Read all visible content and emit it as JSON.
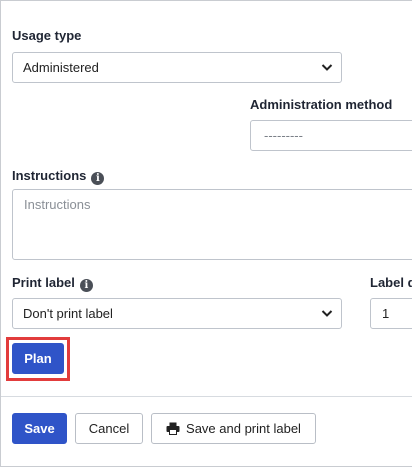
{
  "usage_type": {
    "label": "Usage type",
    "value": "Administered"
  },
  "administration_method": {
    "label": "Administration method",
    "value": "---------"
  },
  "instructions": {
    "label": "Instructions",
    "placeholder": "Instructions"
  },
  "print_label": {
    "label": "Print label",
    "value": "Don't print label"
  },
  "label_quantity": {
    "label": "Label q",
    "value": "1"
  },
  "buttons": {
    "plan": "Plan",
    "save": "Save",
    "cancel": "Cancel",
    "save_and_print": "Save and print label"
  },
  "colors": {
    "primary": "#2f54c8",
    "highlight": "#e23c3c"
  },
  "icons": [
    "info-icon",
    "chevron-down-icon",
    "printer-icon"
  ]
}
